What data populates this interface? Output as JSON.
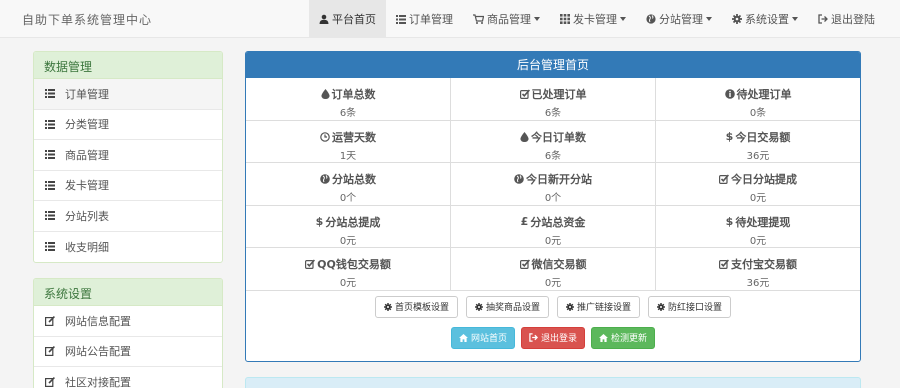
{
  "brand": "自助下单系统管理中心",
  "nav": [
    {
      "label": "平台首页",
      "icon": "user-icon",
      "active": true,
      "dropdown": false
    },
    {
      "label": "订单管理",
      "icon": "list-icon",
      "active": false,
      "dropdown": false
    },
    {
      "label": "商品管理",
      "icon": "cart-icon",
      "active": false,
      "dropdown": true
    },
    {
      "label": "发卡管理",
      "icon": "grid-icon",
      "active": false,
      "dropdown": true
    },
    {
      "label": "分站管理",
      "icon": "globe-icon",
      "active": false,
      "dropdown": true
    },
    {
      "label": "系统设置",
      "icon": "gear-icon",
      "active": false,
      "dropdown": true
    },
    {
      "label": "退出登陆",
      "icon": "logout-icon",
      "active": false,
      "dropdown": false
    }
  ],
  "sidebar_data": {
    "title": "数据管理",
    "items": [
      "订单管理",
      "分类管理",
      "商品管理",
      "发卡管理",
      "分站列表",
      "收支明细"
    ]
  },
  "sidebar_system": {
    "title": "系统设置",
    "items": [
      "网站信息配置",
      "网站公告配置",
      "社区对接配置"
    ]
  },
  "main": {
    "title": "后台管理首页",
    "stats": [
      [
        {
          "icon": "drop-icon",
          "label": "订单总数",
          "value": "6条"
        },
        {
          "icon": "check-icon",
          "label": "已处理订单",
          "value": "6条"
        },
        {
          "icon": "info-icon",
          "label": "待处理订单",
          "value": "0条"
        }
      ],
      [
        {
          "icon": "clock-icon",
          "label": "运营天数",
          "value": "1天"
        },
        {
          "icon": "drop-icon",
          "label": "今日订单数",
          "value": "6条"
        },
        {
          "icon": "dollar-icon",
          "label": "今日交易额",
          "value": "36元"
        }
      ],
      [
        {
          "icon": "globe-icon",
          "label": "分站总数",
          "value": "0个"
        },
        {
          "icon": "globe-icon",
          "label": "今日新开分站",
          "value": "0个"
        },
        {
          "icon": "check-icon",
          "label": "今日分站提成",
          "value": "0元"
        }
      ],
      [
        {
          "icon": "dollar-icon",
          "label": "分站总提成",
          "value": "0元"
        },
        {
          "icon": "pound-icon",
          "label": "分站总资金",
          "value": "0元"
        },
        {
          "icon": "dollar-icon",
          "label": "待处理提现",
          "value": "0元"
        }
      ],
      [
        {
          "icon": "check-icon",
          "label": "QQ钱包交易额",
          "value": "0元"
        },
        {
          "icon": "check-icon",
          "label": "微信交易额",
          "value": "0元"
        },
        {
          "icon": "check-icon",
          "label": "支付宝交易额",
          "value": "36元"
        }
      ]
    ],
    "settings_buttons": [
      "首页模板设置",
      "抽奖商品设置",
      "推广链接设置",
      "防红接口设置"
    ],
    "action_buttons": [
      {
        "label": "网站首页",
        "icon": "home-icon",
        "color": "#5bc0de"
      },
      {
        "label": "退出登录",
        "icon": "logout-icon",
        "color": "#d9534f"
      },
      {
        "label": "检测更新",
        "icon": "home-icon",
        "color": "#5cb85c"
      }
    ]
  }
}
